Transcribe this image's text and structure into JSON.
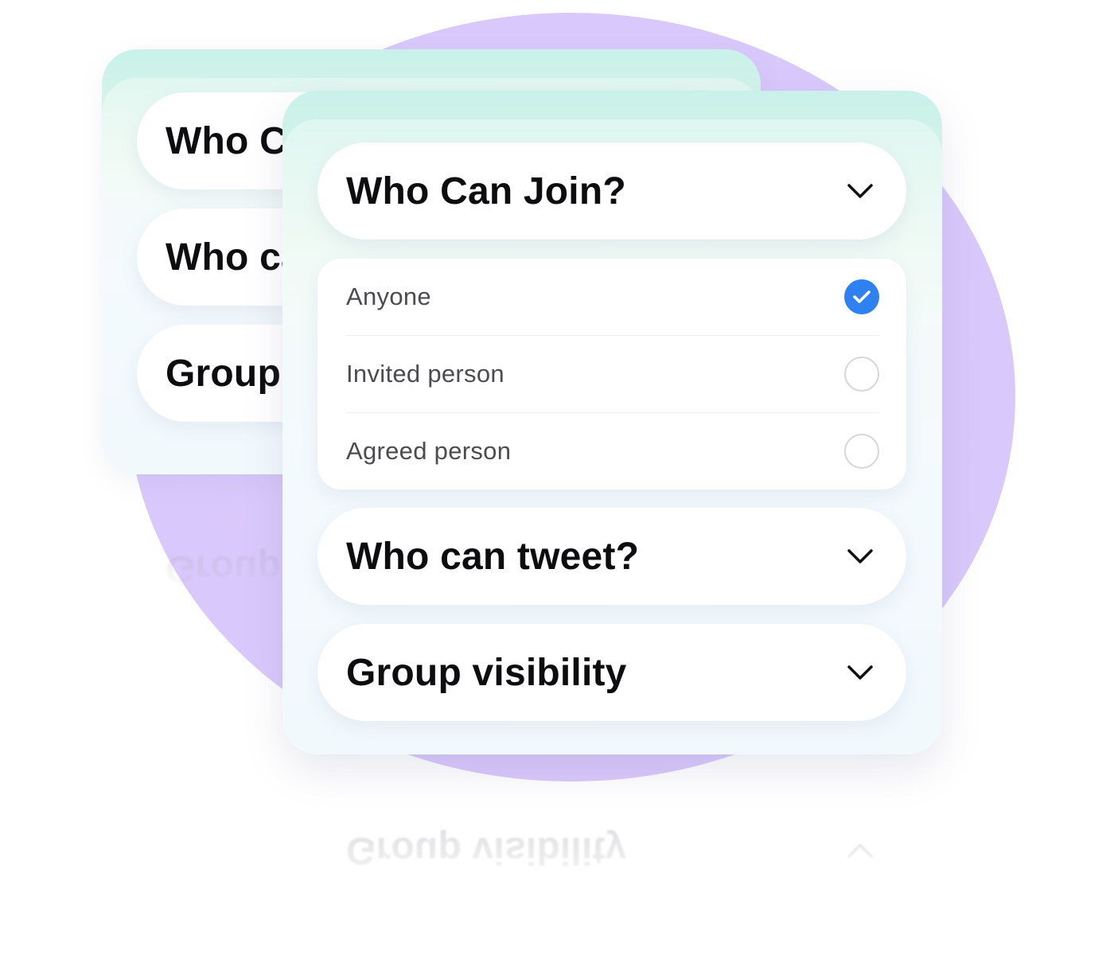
{
  "background_panel": {
    "items": [
      {
        "label": "Who Can Join?"
      },
      {
        "label": "Who can tweet?"
      },
      {
        "label": "Group visibility"
      }
    ]
  },
  "settings_panel": {
    "sections": [
      {
        "label": "Who Can Join?",
        "chevron": "chevron-down-icon",
        "expanded": true
      },
      {
        "label": "Who can tweet?",
        "chevron": "chevron-down-icon",
        "expanded": false
      },
      {
        "label": "Group visibility",
        "chevron": "chevron-down-icon",
        "expanded": false
      }
    ],
    "join_options": [
      {
        "label": "Anyone",
        "selected": true
      },
      {
        "label": "Invited person",
        "selected": false
      },
      {
        "label": "Agreed person",
        "selected": false
      }
    ]
  },
  "reflection": {
    "label": "Group visibility",
    "icon": "chevron-up-icon"
  },
  "colors": {
    "accent": "#2f80f0",
    "background_circle": "#dccbfb",
    "panel_top": "#c9f1ea",
    "panel_body": "#f1f8fd",
    "text_primary": "#0d0d0f",
    "text_secondary": "#4a4c52"
  }
}
